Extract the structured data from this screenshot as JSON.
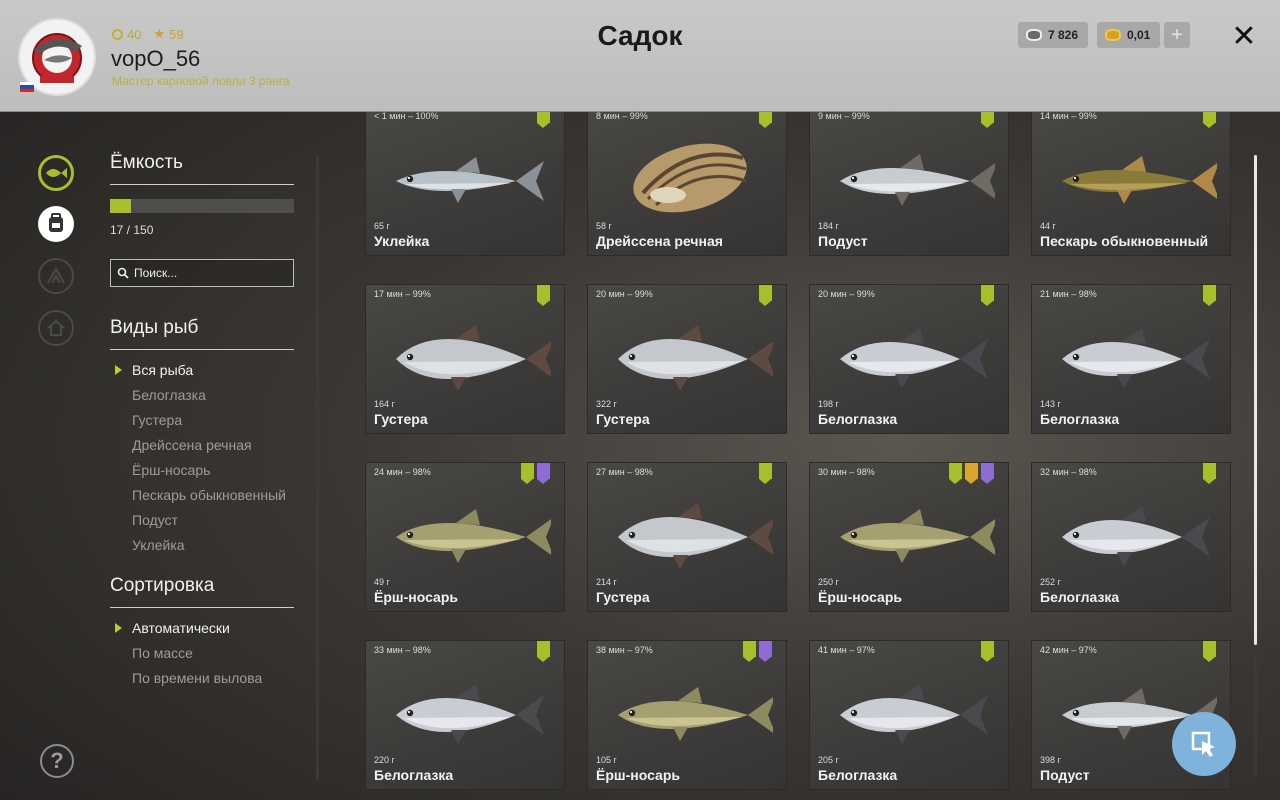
{
  "header": {
    "title": "Садок",
    "player": {
      "coins": "40",
      "stars": "59",
      "username": "vopO_56",
      "rank": "Мастер карповой ловли 3 ранга"
    },
    "silver": "7 826",
    "gold": "0,01",
    "plus_label": "+",
    "close_label": "✕"
  },
  "capacity": {
    "title": "Ёмкость",
    "text": "17 / 150",
    "fill_fraction": 0.113
  },
  "search": {
    "placeholder": "Поиск..."
  },
  "species": {
    "title": "Виды рыб",
    "items": [
      "Вся рыба",
      "Белоглазка",
      "Густера",
      "Дрейссена речная",
      "Ёрш-носарь",
      "Пескарь обыкновенный",
      "Подуст",
      "Уклейка"
    ],
    "active": 0
  },
  "sort": {
    "title": "Сортировка",
    "items": [
      "Автоматически",
      "По массе",
      "По времени вылова"
    ],
    "active": 0
  },
  "help_label": "?",
  "colors": {
    "accent": "#a7bf2b",
    "badge_gold": "#d9a52a",
    "badge_purple": "#8f6bd6",
    "fab": "#7fb3dc"
  },
  "cards": [
    {
      "meta": "< 1 мин – 100%",
      "weight": "65 г",
      "name": "Уклейка",
      "badges": [
        "green"
      ],
      "kind": "bleak"
    },
    {
      "meta": "8 мин – 99%",
      "weight": "58 г",
      "name": "Дрейссена речная",
      "badges": [
        "green"
      ],
      "kind": "mussel"
    },
    {
      "meta": "9 мин – 99%",
      "weight": "184 г",
      "name": "Подуст",
      "badges": [
        "green"
      ],
      "kind": "nase"
    },
    {
      "meta": "14 мин – 99%",
      "weight": "44 г",
      "name": "Пескарь обыкновенный",
      "badges": [
        "green"
      ],
      "kind": "gudgeon"
    },
    {
      "meta": "17 мин – 99%",
      "weight": "164 г",
      "name": "Густера",
      "badges": [
        "green"
      ],
      "kind": "bream"
    },
    {
      "meta": "20 мин – 99%",
      "weight": "322 г",
      "name": "Густера",
      "badges": [
        "green"
      ],
      "kind": "bream"
    },
    {
      "meta": "20 мин – 99%",
      "weight": "198 г",
      "name": "Белоглазка",
      "badges": [
        "green"
      ],
      "kind": "whiteeye"
    },
    {
      "meta": "21 мин – 98%",
      "weight": "143 г",
      "name": "Белоглазка",
      "badges": [
        "green"
      ],
      "kind": "whiteeye"
    },
    {
      "meta": "24 мин – 98%",
      "weight": "49 г",
      "name": "Ёрш-носарь",
      "badges": [
        "green",
        "purple"
      ],
      "kind": "ruffe"
    },
    {
      "meta": "27 мин – 98%",
      "weight": "214 г",
      "name": "Густера",
      "badges": [
        "green"
      ],
      "kind": "bream"
    },
    {
      "meta": "30 мин – 98%",
      "weight": "250 г",
      "name": "Ёрш-носарь",
      "badges": [
        "green",
        "gold",
        "purple"
      ],
      "kind": "ruffe"
    },
    {
      "meta": "32 мин – 98%",
      "weight": "252 г",
      "name": "Белоглазка",
      "badges": [
        "green"
      ],
      "kind": "whiteeye"
    },
    {
      "meta": "33 мин – 98%",
      "weight": "220 г",
      "name": "Белоглазка",
      "badges": [
        "green"
      ],
      "kind": "whiteeye"
    },
    {
      "meta": "38 мин – 97%",
      "weight": "105 г",
      "name": "Ёрш-носарь",
      "badges": [
        "green",
        "purple"
      ],
      "kind": "ruffe"
    },
    {
      "meta": "41 мин – 97%",
      "weight": "205 г",
      "name": "Белоглазка",
      "badges": [
        "green"
      ],
      "kind": "whiteeye"
    },
    {
      "meta": "42 мин – 97%",
      "weight": "398 г",
      "name": "Подуст",
      "badges": [
        "green"
      ],
      "kind": "nase"
    }
  ]
}
